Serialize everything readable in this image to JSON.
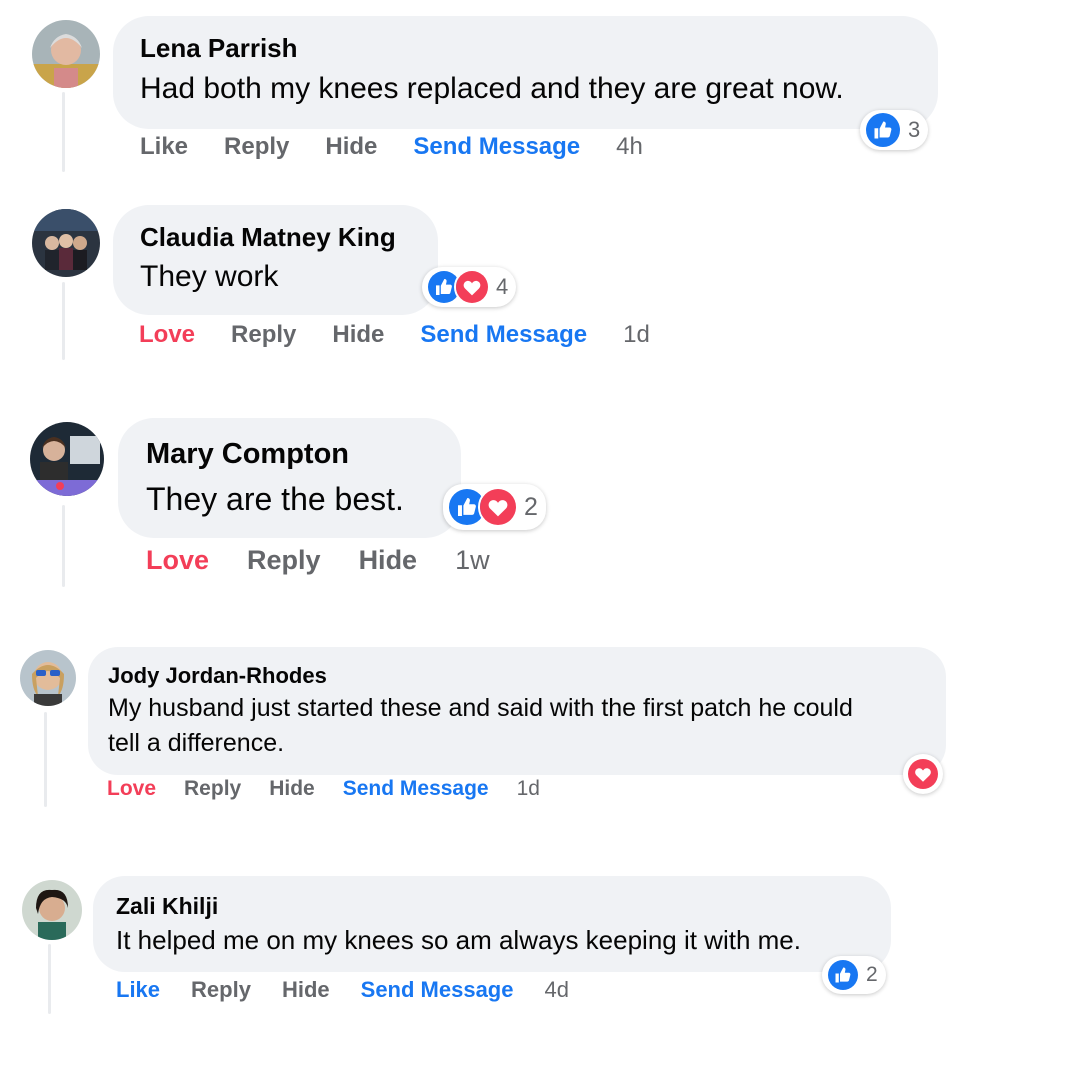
{
  "comments": [
    {
      "name": "Lena Parrish",
      "text": "Had both my knees replaced and they are great now.",
      "actions": [
        "Like",
        "Reply",
        "Hide",
        "Send Message"
      ],
      "time": "4h",
      "reaction_count": "3",
      "reactions": [
        "like-icon"
      ]
    },
    {
      "name": "Claudia Matney King",
      "text": "They work",
      "actions": [
        "Love",
        "Reply",
        "Hide",
        "Send Message"
      ],
      "time": "1d",
      "reaction_count": "4",
      "reactions": [
        "like-icon",
        "heart-icon"
      ]
    },
    {
      "name": "Mary Compton",
      "text": "They are the best.",
      "actions": [
        "Love",
        "Reply",
        "Hide"
      ],
      "time": "1w",
      "reaction_count": "2",
      "reactions": [
        "like-icon",
        "heart-icon"
      ]
    },
    {
      "name": "Jody Jordan-Rhodes",
      "text_lines": [
        "My husband just started these and said with the first patch he could",
        "tell a difference."
      ],
      "actions": [
        "Love",
        "Reply",
        "Hide",
        "Send Message"
      ],
      "time": "1d",
      "reaction_count": "",
      "reactions": [
        "heart-icon"
      ]
    },
    {
      "name": "Zali Khilji",
      "text": "It helped me on my knees so am always keeping it with me.",
      "actions": [
        "Like",
        "Reply",
        "Hide",
        "Send Message"
      ],
      "time": "4d",
      "reaction_count": "2",
      "reactions": [
        "like-icon"
      ]
    }
  ],
  "colors": {
    "like_blue": "#1877f2",
    "love_red": "#f33e58",
    "bubble_bg": "#f0f2f5",
    "meta_gray": "#65676b"
  }
}
